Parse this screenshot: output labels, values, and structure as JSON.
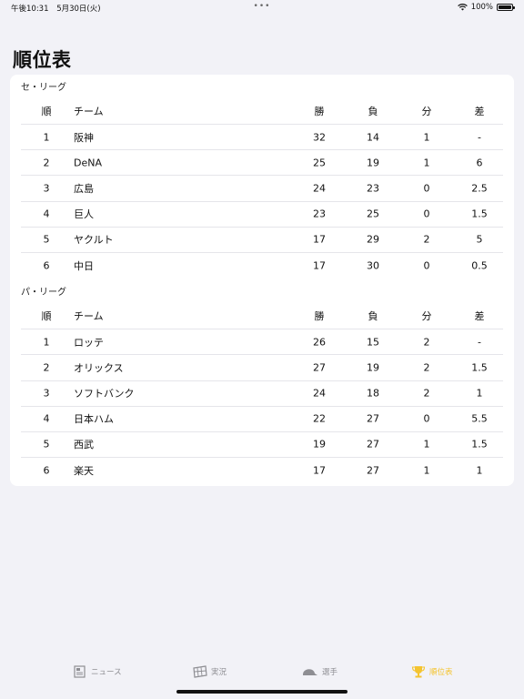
{
  "status": {
    "time": "午後10:31",
    "date": "5月30日(火)",
    "battery": "100%"
  },
  "page_title": "順位表",
  "columns": {
    "rank": "順",
    "team": "チーム",
    "win": "勝",
    "loss": "負",
    "draw": "分",
    "gb": "差"
  },
  "leagues": [
    {
      "name": "セ・リーグ",
      "rows": [
        {
          "rank": "1",
          "team": "阪神",
          "win": "32",
          "loss": "14",
          "draw": "1",
          "gb": "-"
        },
        {
          "rank": "2",
          "team": "DeNA",
          "win": "25",
          "loss": "19",
          "draw": "1",
          "gb": "6"
        },
        {
          "rank": "3",
          "team": "広島",
          "win": "24",
          "loss": "23",
          "draw": "0",
          "gb": "2.5"
        },
        {
          "rank": "4",
          "team": "巨人",
          "win": "23",
          "loss": "25",
          "draw": "0",
          "gb": "1.5"
        },
        {
          "rank": "5",
          "team": "ヤクルト",
          "win": "17",
          "loss": "29",
          "draw": "2",
          "gb": "5"
        },
        {
          "rank": "6",
          "team": "中日",
          "win": "17",
          "loss": "30",
          "draw": "0",
          "gb": "0.5"
        }
      ]
    },
    {
      "name": "パ・リーグ",
      "rows": [
        {
          "rank": "1",
          "team": "ロッテ",
          "win": "26",
          "loss": "15",
          "draw": "2",
          "gb": "-"
        },
        {
          "rank": "2",
          "team": "オリックス",
          "win": "27",
          "loss": "19",
          "draw": "2",
          "gb": "1.5"
        },
        {
          "rank": "3",
          "team": "ソフトバンク",
          "win": "24",
          "loss": "18",
          "draw": "2",
          "gb": "1"
        },
        {
          "rank": "4",
          "team": "日本ハム",
          "win": "22",
          "loss": "27",
          "draw": "0",
          "gb": "5.5"
        },
        {
          "rank": "5",
          "team": "西武",
          "win": "19",
          "loss": "27",
          "draw": "1",
          "gb": "1.5"
        },
        {
          "rank": "6",
          "team": "楽天",
          "win": "17",
          "loss": "27",
          "draw": "1",
          "gb": "1"
        }
      ]
    }
  ],
  "tabs": [
    {
      "label": "ニュース",
      "icon": "newspaper-icon",
      "active": false
    },
    {
      "label": "実況",
      "icon": "scoreboard-icon",
      "active": false
    },
    {
      "label": "選手",
      "icon": "baseball-cap-icon",
      "active": false
    },
    {
      "label": "順位表",
      "icon": "trophy-icon",
      "active": true
    }
  ],
  "colors": {
    "accent": "#f4c430",
    "inactive": "#8e8e93",
    "background": "#f2f2f7"
  }
}
